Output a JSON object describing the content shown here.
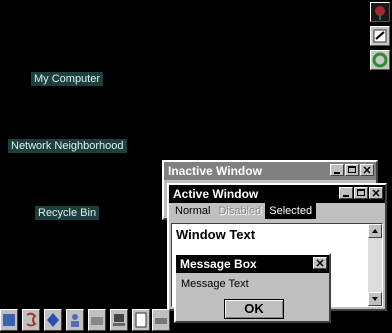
{
  "desktop": {
    "icons": [
      {
        "label": "My Computer"
      },
      {
        "label": "Network Neighborhood"
      },
      {
        "label": "Recycle Bin"
      }
    ]
  },
  "inactive_window": {
    "title": "Inactive Window"
  },
  "active_window": {
    "title": "Active Window",
    "menu": {
      "normal": "Normal",
      "disabled": "Disabled",
      "selected": "Selected"
    },
    "window_text": "Window Text"
  },
  "message_box": {
    "title": "Message Box",
    "text": "Message Text",
    "ok_label": "OK"
  },
  "colors": {
    "desktop": "#000000",
    "active_title": "#000000",
    "inactive_title": "#808080",
    "icon_label_bg": "#1d3f3e",
    "face": "#c0c0c0"
  }
}
